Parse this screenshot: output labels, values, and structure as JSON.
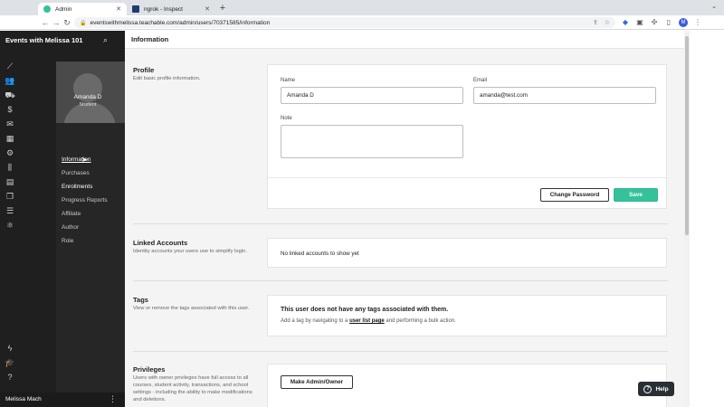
{
  "browser": {
    "tabs": [
      {
        "title": "Admin",
        "favicon_color": "#35c29b",
        "active": true
      },
      {
        "title": "ngrok - Inspect",
        "favicon_color": "#1f3b6d",
        "active": false
      }
    ],
    "new_tab": "+",
    "url": "eventswithmelissa.teachable.com/admin/users/70371585/information",
    "profile_initial": "M"
  },
  "sidebar": {
    "school_name": "Events with Melissa 101",
    "rail_icons": [
      "trend-icon",
      "users-icon",
      "truck-icon",
      "dollar-icon",
      "mail-icon",
      "grid-icon",
      "gear-icon",
      "library-icon",
      "calendar-icon",
      "page-icon",
      "doc-icon",
      "hierarchy-icon"
    ],
    "bottom_icons": [
      "bolt-icon",
      "graduation-icon",
      "question-icon"
    ],
    "user": {
      "name": "Amanda D",
      "role": "Student"
    },
    "subnav": [
      {
        "label": "Information",
        "active": true
      },
      {
        "label": "Purchases"
      },
      {
        "label": "Enrollments"
      },
      {
        "label": "Progress Reports"
      },
      {
        "label": "Affiliate"
      },
      {
        "label": "Author"
      },
      {
        "label": "Role"
      }
    ],
    "owner_name": "Melissa Mach"
  },
  "main": {
    "title": "Information",
    "profile": {
      "title": "Profile",
      "desc": "Edit basic profile information.",
      "name_label": "Name",
      "name_value": "Amanda D",
      "email_label": "Email",
      "email_value": "amanda@test.com",
      "note_label": "Note",
      "change_password": "Change Password",
      "save": "Save"
    },
    "linked": {
      "title": "Linked Accounts",
      "desc": "Identity accounts your users use to simplify login.",
      "empty": "No linked accounts to show yet"
    },
    "tags": {
      "title": "Tags",
      "desc": "View or remove the tags associated with this user.",
      "empty_title": "This user does not have any tags associated with them.",
      "hint_pre": "Add a tag by navigating to a",
      "hint_link": "user list page",
      "hint_post": "and performing a bulk action."
    },
    "privileges": {
      "title": "Privileges",
      "desc": "Users with owner privileges have full access to all courses, student activity, transactions, and school settings - including the ability to make modifications and deletions.",
      "button": "Make Admin/Owner"
    }
  },
  "help": {
    "label": "Help"
  },
  "colors": {
    "accent": "#35c29b",
    "sidebar": "#1f1f1f"
  }
}
